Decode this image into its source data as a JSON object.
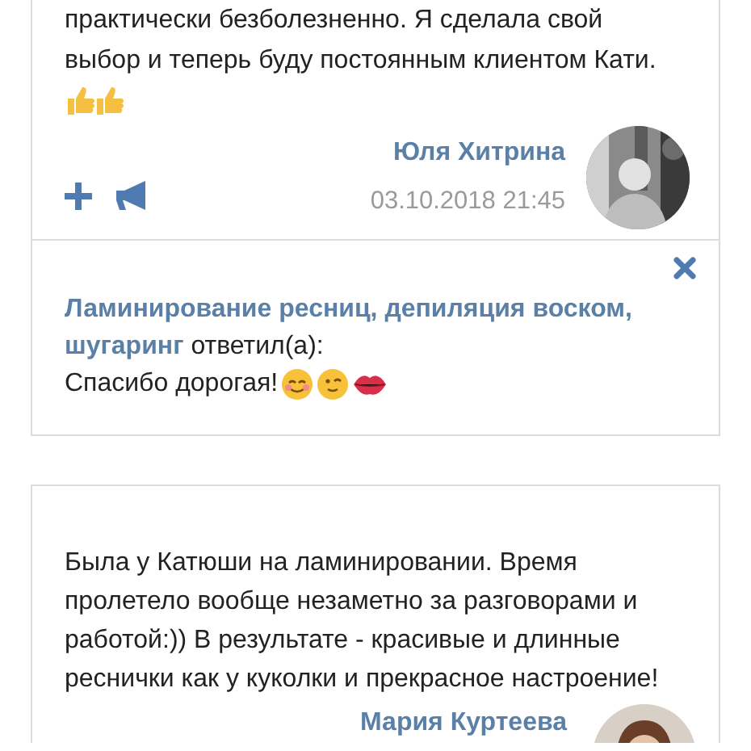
{
  "review": {
    "text": "практически безболезненно. Я сделала свой\nвыбор и теперь буду постоянным клиентом Кати.",
    "author": "Юля Хитрина",
    "date": "03.10.2018 21:45"
  },
  "reply": {
    "from": "Ламинирование ресниц, депиляция воском, шугаринг",
    "verb": "ответил(а):",
    "text": "Спасибо дорогая!"
  },
  "review_2": {
    "text": "Была у Катюши на ламинировании. Время\nпролетело вообще незаметно за разговорами и\nработой:)) В результате - красивые и длинные\nреснички как у куколки и прекрасное настроение!",
    "author": "Мария Куртеева"
  }
}
